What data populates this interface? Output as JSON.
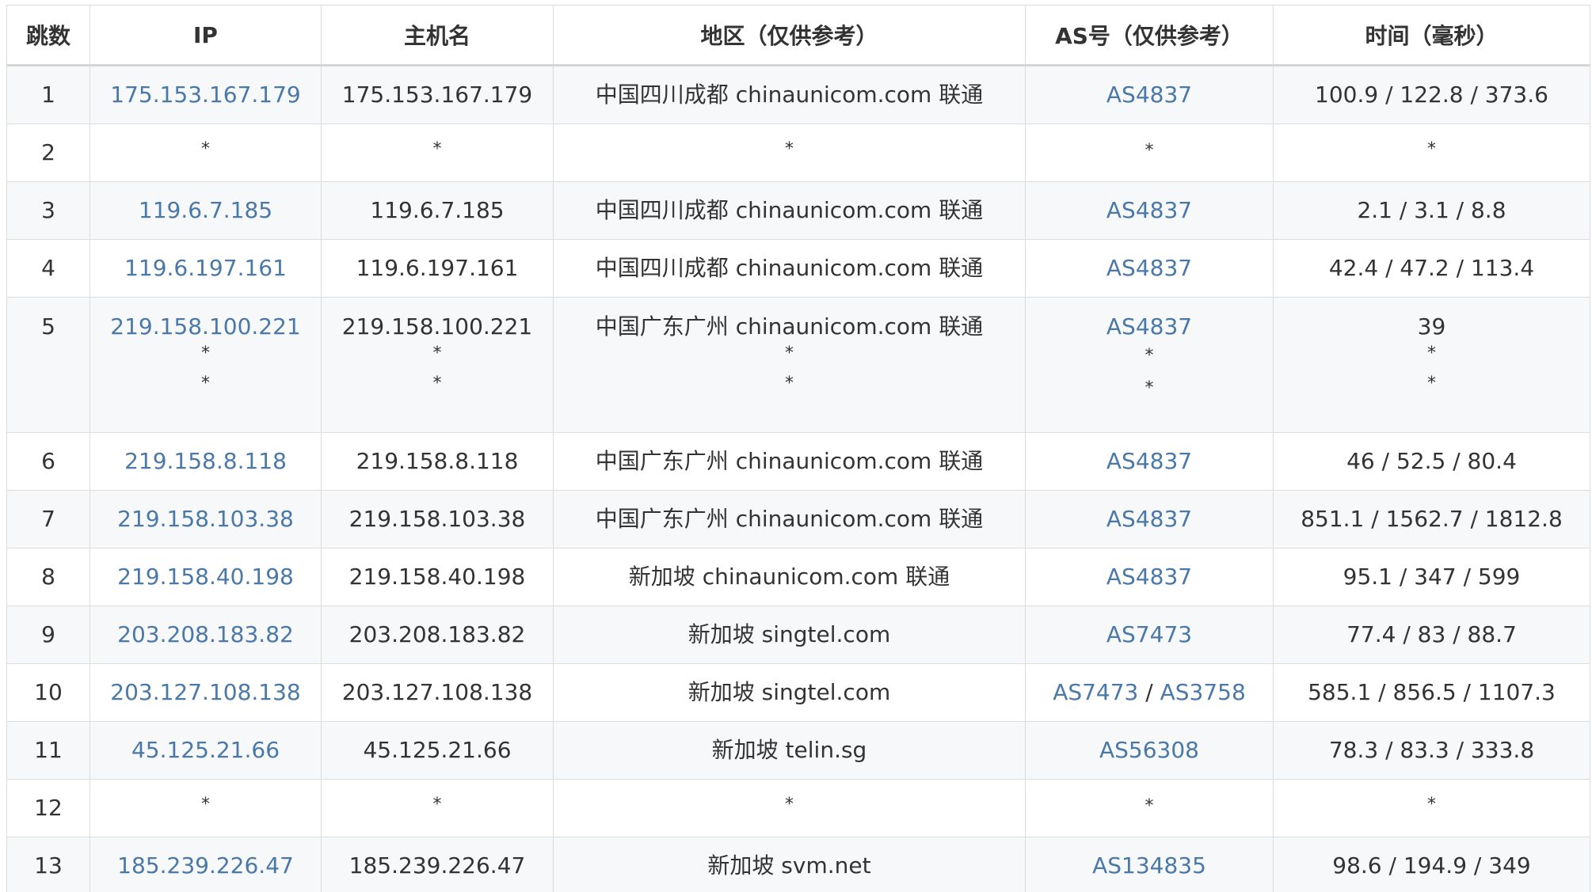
{
  "headers": {
    "hop": "跳数",
    "ip": "IP",
    "hostname": "主机名",
    "region": "地区（仅供参考）",
    "as": "AS号（仅供参考）",
    "time": "时间（毫秒）"
  },
  "rows": [
    {
      "hop": "1",
      "ip": [
        "175.153.167.179"
      ],
      "host": [
        "175.153.167.179"
      ],
      "region": [
        "中国四川成都 chinaunicom.com 联通"
      ],
      "as": [
        [
          "AS4837"
        ]
      ],
      "time": [
        "100.9 / 122.8 / 373.6"
      ]
    },
    {
      "hop": "2",
      "ip": [
        "*"
      ],
      "host": [
        "*"
      ],
      "region": [
        "*"
      ],
      "as": [
        [
          "*"
        ]
      ],
      "time": [
        "*"
      ]
    },
    {
      "hop": "3",
      "ip": [
        "119.6.7.185"
      ],
      "host": [
        "119.6.7.185"
      ],
      "region": [
        "中国四川成都 chinaunicom.com 联通"
      ],
      "as": [
        [
          "AS4837"
        ]
      ],
      "time": [
        "2.1 / 3.1 / 8.8"
      ]
    },
    {
      "hop": "4",
      "ip": [
        "119.6.197.161"
      ],
      "host": [
        "119.6.197.161"
      ],
      "region": [
        "中国四川成都 chinaunicom.com 联通"
      ],
      "as": [
        [
          "AS4837"
        ]
      ],
      "time": [
        "42.4 / 47.2 / 113.4"
      ]
    },
    {
      "hop": "5",
      "ip": [
        "219.158.100.221",
        "*",
        "*"
      ],
      "host": [
        "219.158.100.221",
        "*",
        "*"
      ],
      "region": [
        "中国广东广州 chinaunicom.com 联通",
        "*",
        "*"
      ],
      "as": [
        [
          "AS4837"
        ],
        [
          "*"
        ],
        [
          "*"
        ]
      ],
      "time": [
        "39",
        "*",
        "*"
      ]
    },
    {
      "hop": "6",
      "ip": [
        "219.158.8.118"
      ],
      "host": [
        "219.158.8.118"
      ],
      "region": [
        "中国广东广州 chinaunicom.com 联通"
      ],
      "as": [
        [
          "AS4837"
        ]
      ],
      "time": [
        "46 / 52.5 / 80.4"
      ]
    },
    {
      "hop": "7",
      "ip": [
        "219.158.103.38"
      ],
      "host": [
        "219.158.103.38"
      ],
      "region": [
        "中国广东广州 chinaunicom.com 联通"
      ],
      "as": [
        [
          "AS4837"
        ]
      ],
      "time": [
        "851.1 / 1562.7 / 1812.8"
      ]
    },
    {
      "hop": "8",
      "ip": [
        "219.158.40.198"
      ],
      "host": [
        "219.158.40.198"
      ],
      "region": [
        "新加坡 chinaunicom.com 联通"
      ],
      "as": [
        [
          "AS4837"
        ]
      ],
      "time": [
        "95.1 / 347 / 599"
      ]
    },
    {
      "hop": "9",
      "ip": [
        "203.208.183.82"
      ],
      "host": [
        "203.208.183.82"
      ],
      "region": [
        "新加坡 singtel.com"
      ],
      "as": [
        [
          "AS7473"
        ]
      ],
      "time": [
        "77.4 / 83 / 88.7"
      ]
    },
    {
      "hop": "10",
      "ip": [
        "203.127.108.138"
      ],
      "host": [
        "203.127.108.138"
      ],
      "region": [
        "新加坡 singtel.com"
      ],
      "as": [
        [
          "AS7473",
          "AS3758"
        ]
      ],
      "time": [
        "585.1 / 856.5 / 1107.3"
      ]
    },
    {
      "hop": "11",
      "ip": [
        "45.125.21.66"
      ],
      "host": [
        "45.125.21.66"
      ],
      "region": [
        "新加坡 telin.sg"
      ],
      "as": [
        [
          "AS56308"
        ]
      ],
      "time": [
        "78.3 / 83.3 / 333.8"
      ]
    },
    {
      "hop": "12",
      "ip": [
        "*"
      ],
      "host": [
        "*"
      ],
      "region": [
        "*"
      ],
      "as": [
        [
          "*"
        ]
      ],
      "time": [
        "*"
      ]
    },
    {
      "hop": "13",
      "ip": [
        "185.239.226.47"
      ],
      "host": [
        "185.239.226.47"
      ],
      "region": [
        "新加坡 svm.net"
      ],
      "as": [
        [
          "AS134835"
        ]
      ],
      "time": [
        "98.6 / 194.9 / 349"
      ]
    }
  ],
  "as_separator": " / ",
  "colors": {
    "link": "#4a78a8",
    "text": "#333333",
    "border": "#dcdcdc",
    "row_stripe": "#f7f8f9"
  }
}
